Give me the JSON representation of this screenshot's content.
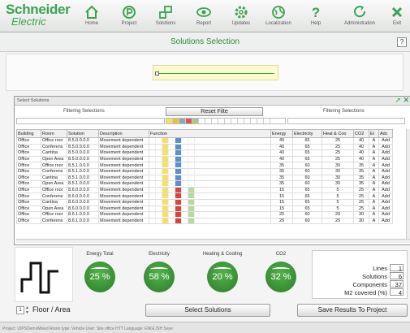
{
  "header": {
    "logo_line1": "Schneider",
    "logo_line2": "Electric"
  },
  "nav": [
    {
      "label": "Home",
      "icon": "home-icon"
    },
    {
      "label": "Project",
      "icon": "project-icon"
    },
    {
      "label": "Solutions",
      "icon": "solutions-icon"
    },
    {
      "label": "Report",
      "icon": "report-icon"
    },
    {
      "label": "Updates",
      "icon": "updates-icon"
    },
    {
      "label": "Localization",
      "icon": "localization-icon"
    },
    {
      "label": "Help",
      "icon": "help-icon"
    },
    {
      "label": "Administration",
      "icon": "administration-icon"
    },
    {
      "label": "Exit",
      "icon": "exit-icon"
    }
  ],
  "page": {
    "title": "Solutions Selection",
    "help": "?"
  },
  "panel": {
    "title": "Select Solutions",
    "filter_left": "Filtering Selections",
    "filter_right": "Filtering Selections",
    "reset": "Reset Filte"
  },
  "table": {
    "headers": [
      "Building",
      "Room",
      "Solution",
      "Description",
      "Function",
      "Energy",
      "Electricity",
      "Heat & Coo",
      "CO2",
      "El",
      "Adc"
    ],
    "rows": [
      [
        "Office",
        "Office roor",
        "8.5.0.0.0.0",
        "Movement dependent",
        "",
        "40",
        "65",
        "25",
        "40",
        "A",
        "Add"
      ],
      [
        "Office",
        "Conferens",
        "8.5.0.0.0.0",
        "Movement dependent",
        "",
        "40",
        "65",
        "25",
        "40",
        "A",
        "Add"
      ],
      [
        "Office",
        "Cantina",
        "8.5.0.0.0.0",
        "Movement dependent",
        "",
        "40",
        "65",
        "25",
        "40",
        "A",
        "Add"
      ],
      [
        "Office",
        "Open Area",
        "8.5.0.0.0.0",
        "Movement dependent",
        "",
        "40",
        "65",
        "25",
        "40",
        "A",
        "Add"
      ],
      [
        "Office",
        "Office roor",
        "8.5.1.0.0.0",
        "Movement dependent",
        "",
        "35",
        "60",
        "30",
        "35",
        "A",
        "Add"
      ],
      [
        "Office",
        "Conferens",
        "8.5.1.0.0.0",
        "Movement dependent",
        "",
        "35",
        "60",
        "30",
        "35",
        "A",
        "Add"
      ],
      [
        "Office",
        "Cantina",
        "8.5.1.0.0.0",
        "Movement dependent",
        "",
        "35",
        "60",
        "30",
        "35",
        "A",
        "Add"
      ],
      [
        "Office",
        "Open Area",
        "8.5.1.0.0.0",
        "Movement dependent",
        "",
        "35",
        "60",
        "30",
        "35",
        "A",
        "Add"
      ],
      [
        "Office",
        "Office roor",
        "8.6.0.0.0.0",
        "Movement dependent",
        "",
        "15",
        "65",
        "5",
        "25",
        "A",
        "Add"
      ],
      [
        "Office",
        "Conferens",
        "8.6.0.0.0.0",
        "Movement dependent",
        "",
        "15",
        "65",
        "5",
        "25",
        "A",
        "Add"
      ],
      [
        "Office",
        "Cantina",
        "8.6.0.0.0.0",
        "Movement dependent",
        "",
        "15",
        "65",
        "5",
        "25",
        "A",
        "Add"
      ],
      [
        "Office",
        "Open Area",
        "8.6.0.0.0.0",
        "Movement dependent",
        "",
        "15",
        "65",
        "5",
        "25",
        "A",
        "Add"
      ],
      [
        "Office",
        "Office roor",
        "8.6.1.0.0.0",
        "Movement dependent",
        "",
        "20",
        "60",
        "20",
        "30",
        "A",
        "Add"
      ],
      [
        "Office",
        "Conferens",
        "8.6.1.0.0.0",
        "Movement dependent",
        "",
        "20",
        "60",
        "20",
        "30",
        "A",
        "Add"
      ]
    ]
  },
  "gauges": [
    {
      "label": "Energy Total",
      "value": "25 %"
    },
    {
      "label": "Electricity",
      "value": "58 %"
    },
    {
      "label": "Heating & Cooling",
      "value": "20 %"
    },
    {
      "label": "CO2",
      "value": "32 %"
    }
  ],
  "stats": [
    {
      "label": "Lines",
      "value": "1"
    },
    {
      "label": "Solutions",
      "value": "6"
    },
    {
      "label": "Components",
      "value": "37"
    },
    {
      "label": "M2 covered (%)",
      "value": "4"
    }
  ],
  "footer": {
    "floor_number": "1",
    "floor_label": "Floor / Area",
    "select_btn": "Select Solutions",
    "save_btn": "Save Results To Project"
  },
  "status": "Project: UIPSDemoMixed          Room type: Vehicle          User:         Site office HTT          Language:         ENGLISH         Save"
}
